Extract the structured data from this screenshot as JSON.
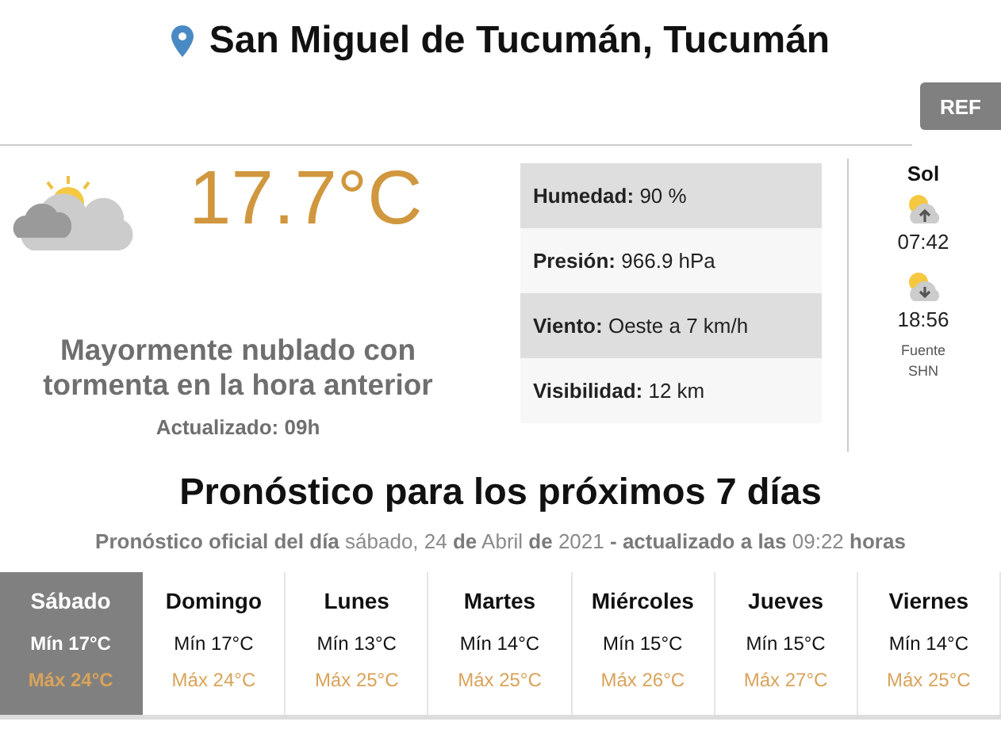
{
  "location": {
    "title": "San Miguel de Tucumán, Tucumán"
  },
  "ref_button": "REF",
  "current": {
    "temperature": "17.7°C",
    "description": "Mayormente nublado con tormenta en la hora anterior",
    "updated": "Actualizado: 09h"
  },
  "details": [
    {
      "label": "Humedad:",
      "value": "90 %"
    },
    {
      "label": "Presión:",
      "value": "966.9 hPa"
    },
    {
      "label": "Viento:",
      "value": "Oeste a 7 km/h"
    },
    {
      "label": "Visibilidad:",
      "value": "12 km"
    }
  ],
  "sun": {
    "title": "Sol",
    "events": [
      {
        "kind": "sunrise",
        "time": "07:42"
      },
      {
        "kind": "sunset",
        "time": "18:56"
      }
    ],
    "source": [
      "Fuente",
      "SHN"
    ]
  },
  "forecast": {
    "title": "Pronóstico para los próximos 7 días",
    "subtitle": "**Pronóstico oficial del día** sábado, 24 **de** Abril **de** 2021 **- actualizado a las** 09:22 **horas**",
    "days": [
      {
        "name": "Sábado",
        "min": "Mín 17°C",
        "max": "Máx 24°C",
        "selected": true
      },
      {
        "name": "Domingo",
        "min": "Mín 17°C",
        "max": "Máx 24°C",
        "selected": false
      },
      {
        "name": "Lunes",
        "min": "Mín 13°C",
        "max": "Máx 25°C",
        "selected": false
      },
      {
        "name": "Martes",
        "min": "Mín 14°C",
        "max": "Máx 25°C",
        "selected": false
      },
      {
        "name": "Miércoles",
        "min": "Mín 15°C",
        "max": "Máx 26°C",
        "selected": false
      },
      {
        "name": "Jueves",
        "min": "Mín 15°C",
        "max": "Máx 27°C",
        "selected": false
      },
      {
        "name": "Viernes",
        "min": "Mín 14°C",
        "max": "Máx 25°C",
        "selected": false
      }
    ]
  }
}
